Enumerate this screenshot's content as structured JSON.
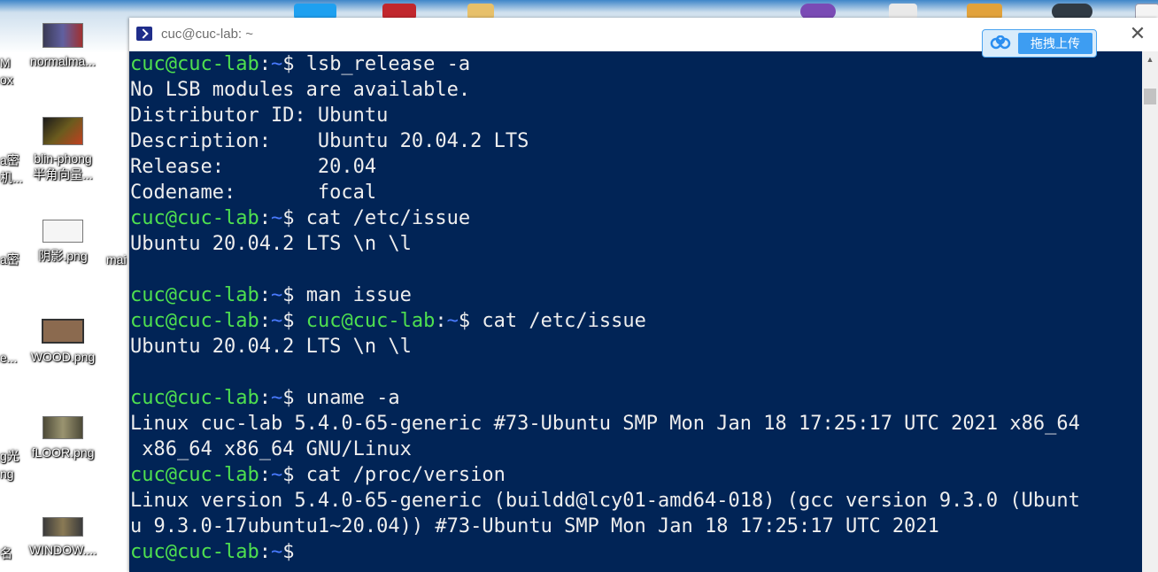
{
  "window": {
    "title": "cuc@cuc-lab: ~",
    "close_glyph": "✕"
  },
  "upload_widget": {
    "label": "拖拽上传"
  },
  "desktop_icons": [
    {
      "label_line1": "normalma...",
      "label_line2": ""
    },
    {
      "label_line1": "blin-phong",
      "label_line2": "半角向量..."
    },
    {
      "label_line1": "阴影.png",
      "label_line2": ""
    },
    {
      "label_line1": "WOOD.png",
      "label_line2": ""
    },
    {
      "label_line1": "fLOOR.png",
      "label_line2": ""
    },
    {
      "label_line1": "WINDOW....",
      "label_line2": ""
    }
  ],
  "desktop_cut_labels": [
    "M",
    "ox",
    "a密",
    "机...",
    "a密",
    "mai",
    "e...",
    "g光",
    "ng",
    "名"
  ],
  "terminal": {
    "prompt_user": "cuc@cuc-lab",
    "prompt_sep": ":",
    "prompt_path": "~",
    "prompt_symbol": "$",
    "lines": [
      {
        "type": "prompt",
        "cmd": " lsb_release -a"
      },
      {
        "type": "out",
        "text": "No LSB modules are available."
      },
      {
        "type": "out",
        "text": "Distributor ID: Ubuntu"
      },
      {
        "type": "out",
        "text": "Description:    Ubuntu 20.04.2 LTS"
      },
      {
        "type": "out",
        "text": "Release:        20.04"
      },
      {
        "type": "out",
        "text": "Codename:       focal"
      },
      {
        "type": "prompt",
        "cmd": " cat /etc/issue"
      },
      {
        "type": "out",
        "text": "Ubuntu 20.04.2 LTS \\n \\l"
      },
      {
        "type": "out",
        "text": ""
      },
      {
        "type": "prompt",
        "cmd": " man issue"
      },
      {
        "type": "prompt2",
        "cmd": " cat /etc/issue"
      },
      {
        "type": "out",
        "text": "Ubuntu 20.04.2 LTS \\n \\l"
      },
      {
        "type": "out",
        "text": ""
      },
      {
        "type": "prompt",
        "cmd": " uname -a"
      },
      {
        "type": "out",
        "text": "Linux cuc-lab 5.4.0-65-generic #73-Ubuntu SMP Mon Jan 18 17:25:17 UTC 2021 x86_64"
      },
      {
        "type": "out",
        "text": " x86_64 x86_64 GNU/Linux"
      },
      {
        "type": "prompt",
        "cmd": " cat /proc/version"
      },
      {
        "type": "out",
        "text": "Linux version 5.4.0-65-generic (buildd@lcy01-amd64-018) (gcc version 9.3.0 (Ubunt"
      },
      {
        "type": "out",
        "text": "u 9.3.0-17ubuntu1~20.04)) #73-Ubuntu SMP Mon Jan 18 17:25:17 UTC 2021"
      },
      {
        "type": "prompt",
        "cmd": ""
      }
    ]
  },
  "colors": {
    "terminal_bg": "#012456",
    "prompt_user": "#4fe04f",
    "prompt_path": "#4a7bff",
    "text": "#eeeeee"
  }
}
